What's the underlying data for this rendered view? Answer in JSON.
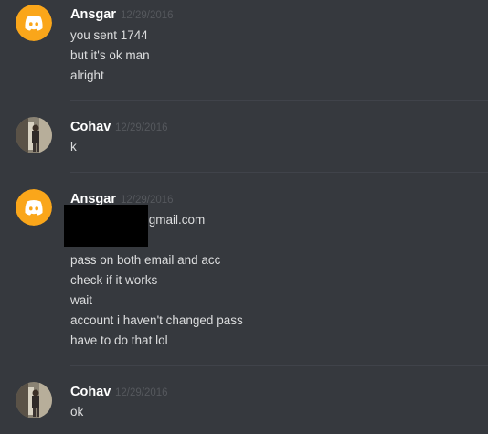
{
  "messages": [
    {
      "username": "Ansgar",
      "timestamp": "12/29/2016",
      "avatar": "discord-logo-icon",
      "lines": [
        "you sent 1744",
        "but it's ok man",
        "alright"
      ]
    },
    {
      "username": "Cohav",
      "timestamp": "12/29/2016",
      "avatar": "user-photo-avatar",
      "lines": [
        "k"
      ]
    },
    {
      "username": "Ansgar",
      "timestamp": "12/29/2016",
      "avatar": "discord-logo-icon",
      "email_suffix": "@gmail.com",
      "lines": [
        "pass on both email and acc",
        "check if it works",
        "wait",
        "account i haven't changed pass",
        "have to do that lol"
      ]
    },
    {
      "username": "Cohav",
      "timestamp": "12/29/2016",
      "avatar": "user-photo-avatar",
      "lines": [
        "ok"
      ]
    }
  ],
  "colors": {
    "background": "#36393e",
    "discord_avatar_bg": "#faa61a",
    "divider": "#40434a"
  }
}
